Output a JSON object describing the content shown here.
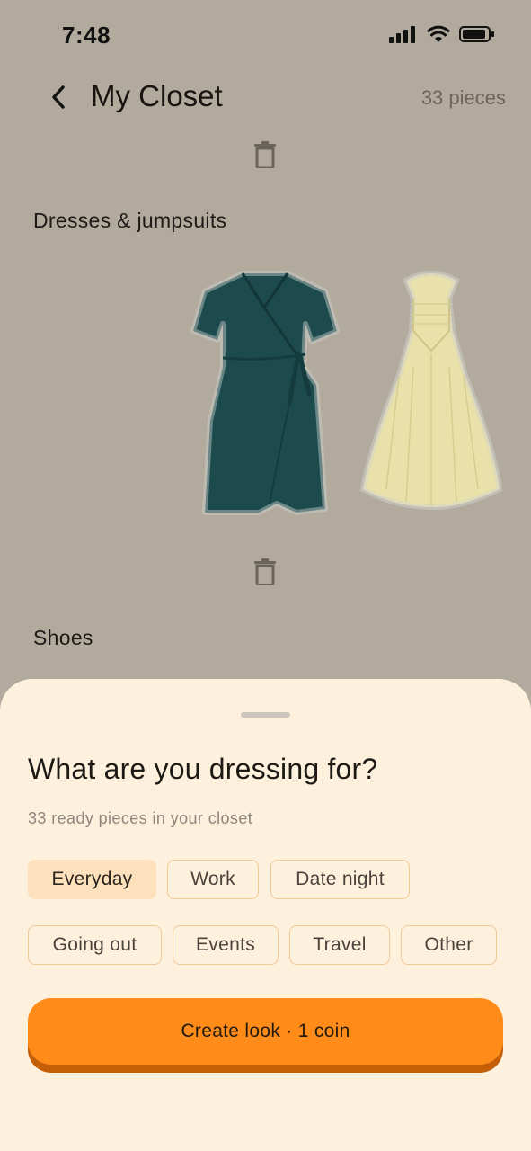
{
  "status_bar": {
    "time": "7:48",
    "icons": [
      "signal-icon",
      "wifi-icon",
      "battery-icon"
    ]
  },
  "header": {
    "title": "My Closet",
    "count": "33 pieces"
  },
  "sections": [
    {
      "title": "Dresses & jumpsuits",
      "items": [
        "green-wrap-dress",
        "yellow-halter-dress"
      ]
    },
    {
      "title": "Shoes"
    }
  ],
  "sheet": {
    "question": "What are you dressing for?",
    "subtitle": "33 ready pieces in your closet",
    "chips": [
      {
        "label": "Everyday",
        "selected": true
      },
      {
        "label": "Work"
      },
      {
        "label": "Date night"
      },
      {
        "label": "Going out"
      },
      {
        "label": "Events"
      },
      {
        "label": "Travel"
      },
      {
        "label": "Other"
      }
    ],
    "cta_label": "Create look · 1 coin"
  },
  "colors": {
    "accent": "#ff8c18",
    "sheet_bg": "#fdf0dc",
    "overlay": "#b3aa9e",
    "chip_selected": "#fde1bd"
  }
}
